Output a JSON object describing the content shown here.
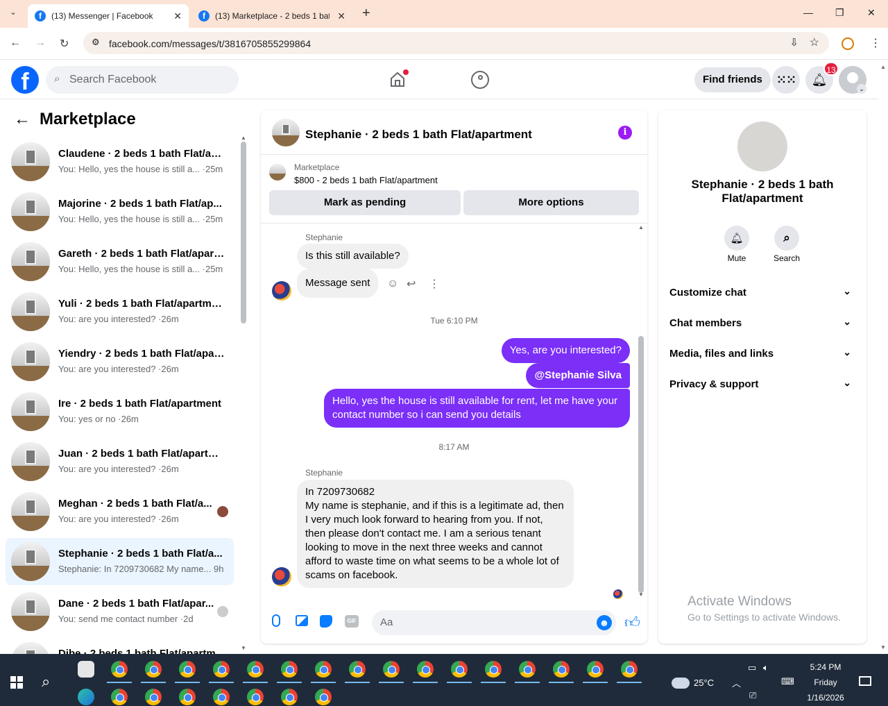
{
  "browser": {
    "tabs": [
      {
        "title": "(13) Messenger | Facebook",
        "active": true
      },
      {
        "title": "(13) Marketplace - 2 beds 1 bat",
        "active": false
      }
    ],
    "new_tab": "+",
    "url": "facebook.com/messages/t/3816705855299864"
  },
  "fb_header": {
    "logo": "f",
    "search_placeholder": "Search Facebook",
    "find_friends": "Find friends",
    "notif_count": "13"
  },
  "sidebar": {
    "title": "Marketplace",
    "conversations": [
      {
        "title": "Claudene · 2 beds 1 bath Flat/ap...",
        "preview": "You: Hello, yes the house is still a... ·25m",
        "seen": false
      },
      {
        "title": "Majorine · 2 beds 1 bath Flat/ap...",
        "preview": "You: Hello, yes the house is still a... ·25m",
        "seen": false
      },
      {
        "title": "Gareth · 2 beds 1 bath Flat/apart...",
        "preview": "You: Hello, yes the house is still a... ·25m",
        "seen": false
      },
      {
        "title": "Yuli · 2 beds 1 bath Flat/apartment",
        "preview": "You: are you interested? ·26m",
        "seen": false
      },
      {
        "title": "Yiendry · 2 beds 1 bath Flat/apar...",
        "preview": "You: are you interested? ·26m",
        "seen": false
      },
      {
        "title": "Ire · 2 beds 1 bath Flat/apartment",
        "preview": "You: yes or no ·26m",
        "seen": false
      },
      {
        "title": "Juan · 2 beds 1 bath Flat/apartm...",
        "preview": "You: are you interested? ·26m",
        "seen": false
      },
      {
        "title": "Meghan · 2 beds 1 bath Flat/a...",
        "preview": "You: are you interested? ·26m",
        "seen": true
      },
      {
        "title": "Stephanie · 2 beds 1 bath Flat/a...",
        "preview": "Stephanie: In 7209730682 My name... 9h",
        "seen": false,
        "selected": true
      },
      {
        "title": "Dane · 2 beds 1 bath Flat/apar...",
        "preview": "You: send me contact number ·2d",
        "seen": true
      },
      {
        "title": "Dibe · 2 beds 1 bath Flat/apartm...",
        "preview": "",
        "seen": false
      }
    ]
  },
  "chat": {
    "title": "Stephanie · 2 beds 1 bath Flat/apartment",
    "marketplace_label": "Marketplace",
    "listing": "$800 - 2 beds 1 bath Flat/apartment",
    "mark_pending": "Mark as pending",
    "more_options": "More options",
    "sender_name": "Stephanie",
    "msg1": "Is this still available?",
    "msg2": "Message sent",
    "ts1": "Tue 6:10 PM",
    "out1": "Yes, are you interested?",
    "out2": "@Stephanie Silva",
    "out3": "Hello, yes the house is still available for rent, let me have your contact number so i can send you details",
    "ts2": "8:17 AM",
    "sender_name2": "Stephanie",
    "msg3": "In 7209730682\nMy name is stephanie, and if this is a legitimate ad, then I very much look forward to hearing from you. If not, then please don't contact me. I am a serious tenant looking to move in the next three weeks and cannot afford to waste time on what seems to be a whole lot of scams on facebook.",
    "composer_placeholder": "Aa",
    "gif_label": "GIF"
  },
  "details": {
    "name": "Stephanie · 2 beds 1 bath Flat/apartment",
    "mute": "Mute",
    "search": "Search",
    "sections": [
      "Customize chat",
      "Chat members",
      "Media, files and links",
      "Privacy & support"
    ]
  },
  "watermark": {
    "line1": "Activate Windows",
    "line2": "Go to Settings to activate Windows."
  },
  "taskbar": {
    "temp": "25°C",
    "time": "5:24 PM",
    "day": "Friday",
    "date": "1/16/2026"
  }
}
